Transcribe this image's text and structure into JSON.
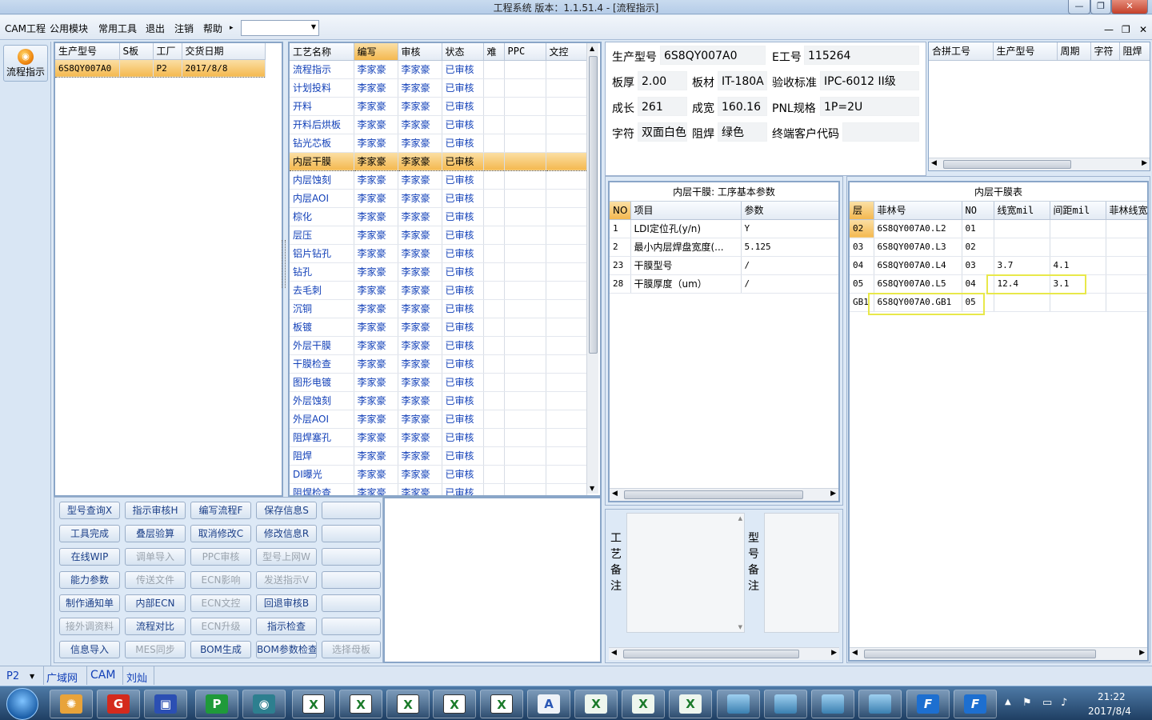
{
  "window": {
    "title": "工程系统   版本：1.1.51.4 - [流程指示]",
    "min": "—",
    "restore": "❐",
    "close": "✕"
  },
  "menu": {
    "items": [
      "CAM工程",
      "公用模块",
      "常用工具",
      "退出",
      "注销",
      "帮助"
    ],
    "help_arrow": "▸",
    "combo_value": "",
    "combo_arrow": "▼"
  },
  "mdi": {
    "min": "—",
    "restore": "❐",
    "close": "✕"
  },
  "nav": {
    "button_label": "流程指示",
    "icon": "flow-icon"
  },
  "orders": {
    "headers": [
      "生产型号",
      "S板",
      "工厂",
      "交货日期"
    ],
    "rows": [
      [
        "6S8QY007A0",
        "",
        "P2",
        "2017/8/8"
      ]
    ]
  },
  "process": {
    "headers": [
      "工艺名称",
      "编写",
      "审核",
      "状态",
      "难",
      "PPC",
      "文控"
    ],
    "rows": [
      [
        "流程指示",
        "李家豪",
        "李家豪",
        "已审核",
        "",
        "",
        ""
      ],
      [
        "计划投料",
        "李家豪",
        "李家豪",
        "已审核",
        "",
        "",
        ""
      ],
      [
        "开料",
        "李家豪",
        "李家豪",
        "已审核",
        "",
        "",
        ""
      ],
      [
        "开料后烘板",
        "李家豪",
        "李家豪",
        "已审核",
        "",
        "",
        ""
      ],
      [
        "钻光芯板",
        "李家豪",
        "李家豪",
        "已审核",
        "",
        "",
        ""
      ],
      [
        "内层干膜",
        "李家豪",
        "李家豪",
        "已审核",
        "",
        "",
        ""
      ],
      [
        "内层蚀刻",
        "李家豪",
        "李家豪",
        "已审核",
        "",
        "",
        ""
      ],
      [
        "内层AOI",
        "李家豪",
        "李家豪",
        "已审核",
        "",
        "",
        ""
      ],
      [
        "棕化",
        "李家豪",
        "李家豪",
        "已审核",
        "",
        "",
        ""
      ],
      [
        "层压",
        "李家豪",
        "李家豪",
        "已审核",
        "",
        "",
        ""
      ],
      [
        "铝片钻孔",
        "李家豪",
        "李家豪",
        "已审核",
        "",
        "",
        ""
      ],
      [
        "钻孔",
        "李家豪",
        "李家豪",
        "已审核",
        "",
        "",
        ""
      ],
      [
        "去毛刺",
        "李家豪",
        "李家豪",
        "已审核",
        "",
        "",
        ""
      ],
      [
        "沉铜",
        "李家豪",
        "李家豪",
        "已审核",
        "",
        "",
        ""
      ],
      [
        "板镀",
        "李家豪",
        "李家豪",
        "已审核",
        "",
        "",
        ""
      ],
      [
        "外层干膜",
        "李家豪",
        "李家豪",
        "已审核",
        "",
        "",
        ""
      ],
      [
        "干膜检查",
        "李家豪",
        "李家豪",
        "已审核",
        "",
        "",
        ""
      ],
      [
        "图形电镀",
        "李家豪",
        "李家豪",
        "已审核",
        "",
        "",
        ""
      ],
      [
        "外层蚀刻",
        "李家豪",
        "李家豪",
        "已审核",
        "",
        "",
        ""
      ],
      [
        "外层AOI",
        "李家豪",
        "李家豪",
        "已审核",
        "",
        "",
        ""
      ],
      [
        "阻焊塞孔",
        "李家豪",
        "李家豪",
        "已审核",
        "",
        "",
        ""
      ],
      [
        "阻焊",
        "李家豪",
        "李家豪",
        "已审核",
        "",
        "",
        ""
      ],
      [
        "DI曝光",
        "李家豪",
        "李家豪",
        "已审核",
        "",
        "",
        ""
      ],
      [
        "阻焊检查",
        "李家豪",
        "李家豪",
        "已审核",
        "",
        "",
        ""
      ]
    ]
  },
  "buttons": [
    [
      "型号查询X",
      "指示审核H",
      "编写流程F",
      "保存信息S",
      ""
    ],
    [
      "工具完成",
      "叠层验算",
      "取消修改C",
      "修改信息R",
      ""
    ],
    [
      "在线WIP",
      "调单导入",
      "PPC审核",
      "型号上网W",
      ""
    ],
    [
      "能力参数",
      "传送文件",
      "ECN影响",
      "发送指示V",
      ""
    ],
    [
      "制作通知单",
      "内部ECN",
      "ECN文控",
      "回退审核B",
      ""
    ],
    [
      "接外调资料",
      "流程对比",
      "ECN升级",
      "指示检查",
      ""
    ],
    [
      "信息导入",
      "MES同步",
      "BOM生成",
      "BOM参数检查",
      "选择母板"
    ]
  ],
  "buttons_disabled": [
    [
      false,
      false,
      false,
      false,
      true
    ],
    [
      false,
      false,
      false,
      false,
      true
    ],
    [
      false,
      true,
      true,
      true,
      true
    ],
    [
      false,
      true,
      true,
      true,
      true
    ],
    [
      false,
      false,
      true,
      false,
      true
    ],
    [
      true,
      false,
      true,
      false,
      true
    ],
    [
      false,
      true,
      false,
      false,
      true
    ]
  ],
  "info": {
    "part_label": "生产型号",
    "part": "6S8QY007A0",
    "ejob_label": "E工号",
    "ejob": "115264",
    "thick_label": "板厚",
    "thick": "2.00",
    "mat_label": "板材",
    "mat": "IT-180A",
    "std_label": "验收标准",
    "std": "IPC-6012 II级",
    "len_label": "成长",
    "len": "261",
    "wid_label": "成宽",
    "wid": "160.16",
    "pnl_label": "PNL规格",
    "pnl": "1P=2U",
    "char_label": "字符",
    "char": "双面白色",
    "mask_label": "阻焊",
    "mask": "绿色",
    "cust_label": "终端客户代码",
    "cust": ""
  },
  "merge": {
    "headers": [
      "合拼工号",
      "生产型号",
      "周期",
      "字符",
      "阻焊"
    ]
  },
  "params": {
    "title": "内层干膜: 工序基本参数",
    "headers": [
      "NO",
      "项目",
      "参数"
    ],
    "rows": [
      [
        "1",
        "LDI定位孔(y/n)",
        "Y"
      ],
      [
        "2",
        "最小内层焊盘宽度(...",
        "5.125"
      ],
      [
        "23",
        "干膜型号",
        "/"
      ],
      [
        "28",
        "干膜厚度（um）",
        "/"
      ]
    ]
  },
  "layers": {
    "title": "内层干膜表",
    "headers": [
      "层",
      "菲林号",
      "NO",
      "线宽mil",
      "间距mil",
      "菲林线宽"
    ],
    "rows": [
      [
        "02",
        "6S8QY007A0.L2",
        "01",
        "",
        "",
        ""
      ],
      [
        "03",
        "6S8QY007A0.L3",
        "02",
        "",
        "",
        ""
      ],
      [
        "04",
        "6S8QY007A0.L4",
        "03",
        "3.7",
        "4.1",
        ""
      ],
      [
        "05",
        "6S8QY007A0.L5",
        "04",
        "12.4",
        "3.1",
        ""
      ],
      [
        "GB1",
        "6S8QY007A0.GB1",
        "05",
        "",
        "",
        ""
      ]
    ]
  },
  "notes": {
    "process_label": "工\n艺\n备\n注",
    "model_label": "型\n号\n备\n注"
  },
  "status": {
    "plant": "P2",
    "arrow": "▼",
    "items": [
      "广域网",
      "CAM",
      "刘灿"
    ]
  },
  "taskbar": {
    "time": "21:22",
    "date": "2017/8/4",
    "apps": [
      "start-orb",
      "shell-app",
      "g-app",
      "save-app",
      "p-app",
      "eye-app",
      "excel-app",
      "excel-app",
      "excel-app",
      "excel-app",
      "excel-app",
      "word-app",
      "excel-app",
      "excel-app",
      "excel-app",
      "picture-app",
      "picture-app",
      "picture-app",
      "picture-app",
      "f-app",
      "f-app"
    ]
  },
  "colors": {
    "accent": "#1240b8",
    "selection": "#f4b84f",
    "highlight": "#e8e84a"
  }
}
